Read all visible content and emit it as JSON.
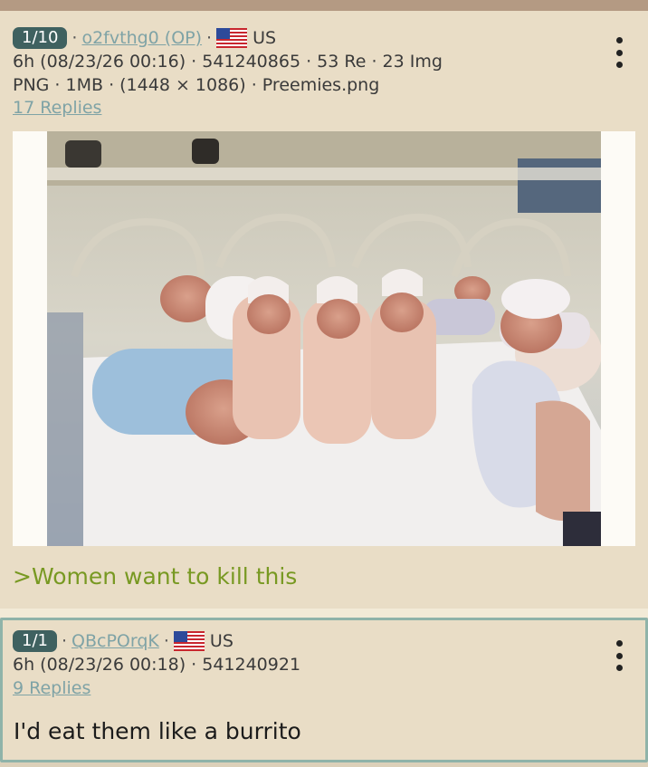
{
  "post1": {
    "index_badge": "1/10",
    "username": "o2fvthg0 (OP)",
    "country": "US",
    "line2": "6h (08/23/26 00:16) · 541240865 · 53 Re · 23 Img",
    "line3": "PNG · 1MB · (1448 × 1086) · Preemies.png",
    "replies": "17 Replies",
    "text": ">Women want to kill this"
  },
  "post2": {
    "index_badge": "1/1",
    "username": "QBcPOrqK",
    "country": "US",
    "line2": "6h (08/23/26 00:18) · 541240921",
    "replies": "9 Replies",
    "text": "I'd eat them like a burrito"
  },
  "icons": {
    "flag": "us-flag-icon",
    "menu": "more-vertical-icon"
  },
  "colors": {
    "background": "#e9ddc6",
    "badge": "#3f6160",
    "link": "#7fa3a6",
    "greentext": "#789922",
    "reply_border": "#8fb3a9"
  }
}
